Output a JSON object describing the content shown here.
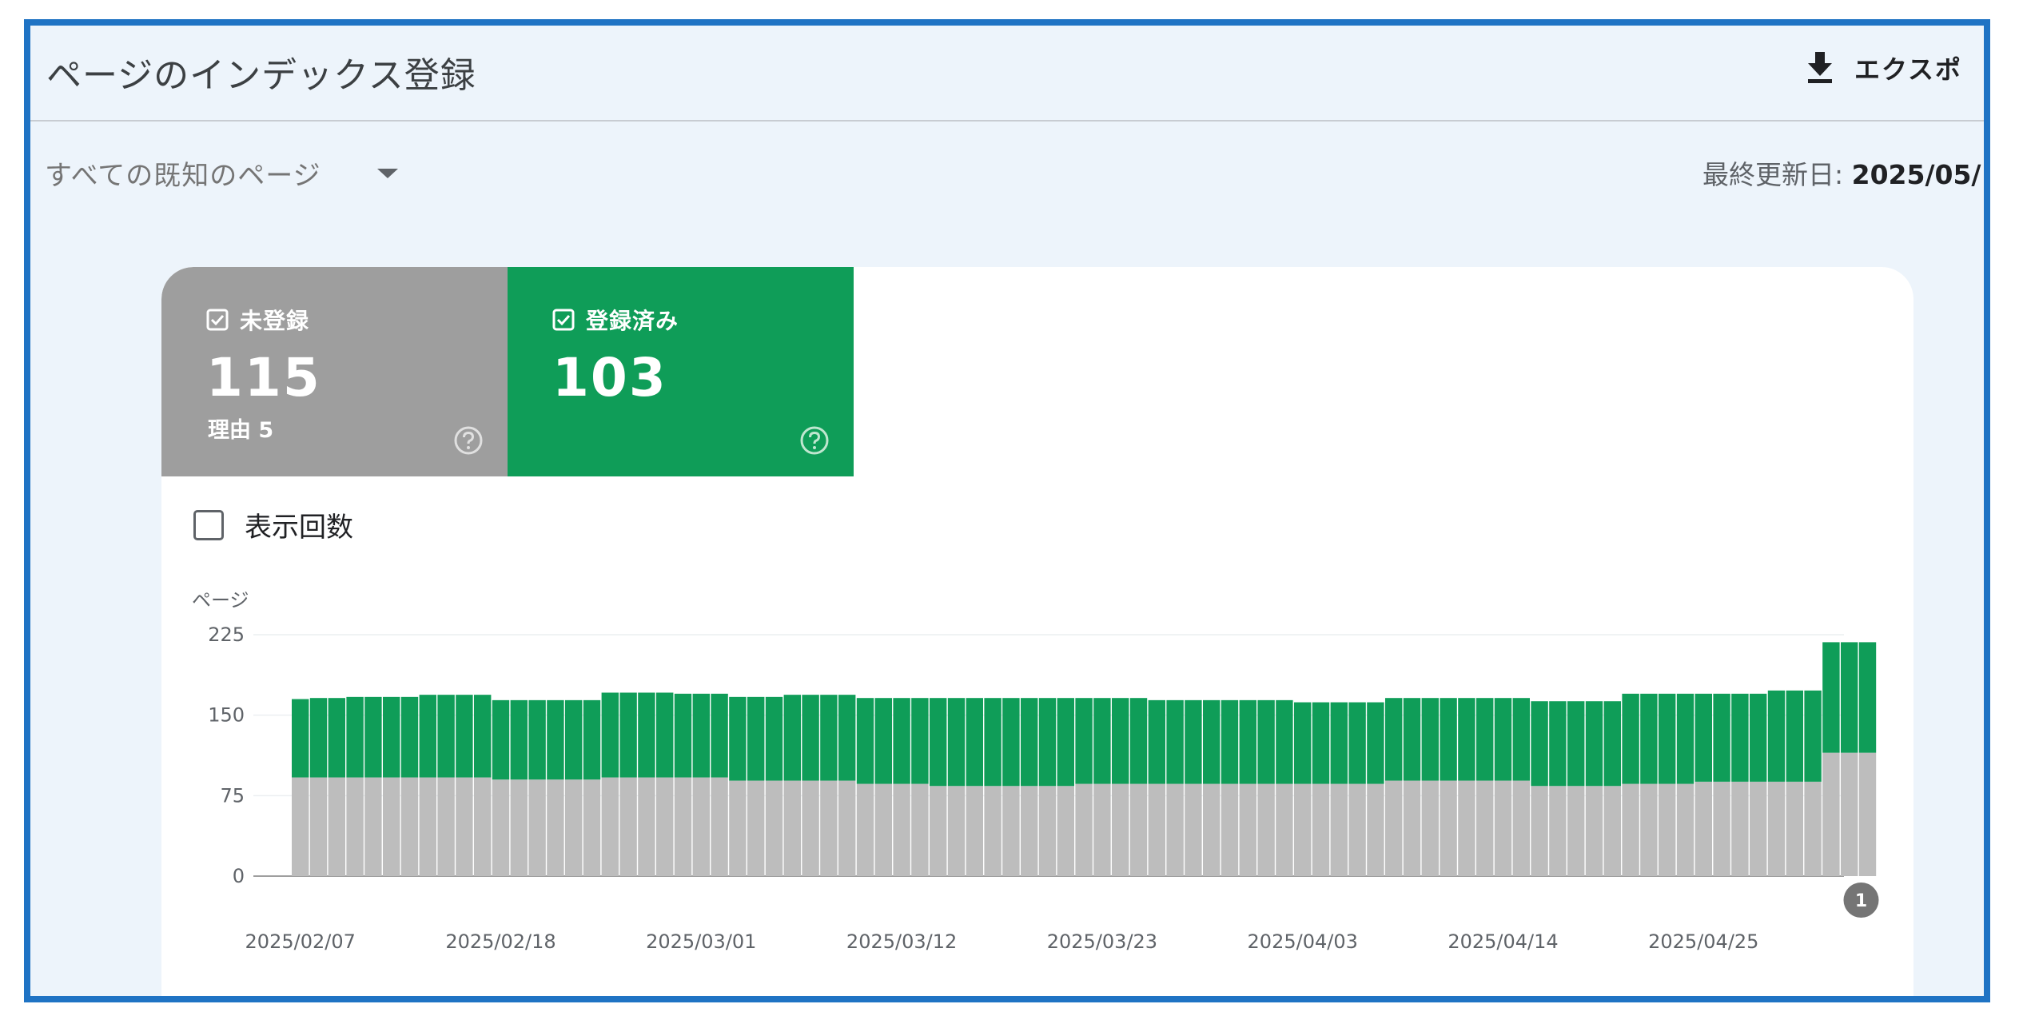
{
  "header": {
    "title": "ページのインデックス登録",
    "export_label": "エクスポ",
    "export_icon": "download-icon"
  },
  "filter": {
    "selected": "すべての既知のページ",
    "icon": "chevron-down-icon"
  },
  "last_updated": {
    "label": "最終更新日: ",
    "value": "2025/05/"
  },
  "summary": {
    "not_indexed": {
      "label": "未登録",
      "count": "115",
      "reason": "理由 5",
      "color": "#9e9e9e"
    },
    "indexed": {
      "label": "登録済み",
      "count": "103",
      "color": "#0f9d58"
    }
  },
  "impressions": {
    "label": "表示回数",
    "checked": false
  },
  "annotation_badge": "1",
  "chart_data": {
    "type": "bar",
    "stacked": true,
    "ylabel": "ページ",
    "ylim": [
      0,
      225
    ],
    "yticks": [
      0,
      75,
      150,
      225
    ],
    "xticks": [
      "2025/02/07",
      "2025/02/18",
      "2025/03/01",
      "2025/03/12",
      "2025/03/23",
      "2025/04/03",
      "2025/04/14",
      "2025/04/25"
    ],
    "grid": true,
    "start_date": "2025/02/07",
    "series": [
      {
        "name": "未登録",
        "color": "#bdbdbd",
        "values": [
          92,
          92,
          92,
          92,
          92,
          92,
          92,
          92,
          92,
          92,
          92,
          90,
          90,
          90,
          90,
          90,
          90,
          92,
          92,
          92,
          92,
          92,
          92,
          92,
          89,
          89,
          89,
          89,
          89,
          89,
          89,
          86,
          86,
          86,
          86,
          84,
          84,
          84,
          84,
          84,
          84,
          84,
          84,
          86,
          86,
          86,
          86,
          86,
          86,
          86,
          86,
          86,
          86,
          86,
          86,
          86,
          86,
          86,
          86,
          86,
          89,
          89,
          89,
          89,
          89,
          89,
          89,
          89,
          84,
          84,
          84,
          84,
          84,
          86,
          86,
          86,
          86,
          88,
          88,
          88,
          88,
          88,
          88,
          88,
          115,
          115,
          115
        ]
      },
      {
        "name": "登録済み",
        "color": "#0f9d58",
        "values": [
          73,
          74,
          74,
          75,
          75,
          75,
          75,
          77,
          77,
          77,
          77,
          74,
          74,
          74,
          74,
          74,
          74,
          79,
          79,
          79,
          79,
          78,
          78,
          78,
          78,
          78,
          78,
          80,
          80,
          80,
          80,
          80,
          80,
          80,
          80,
          82,
          82,
          82,
          82,
          82,
          82,
          82,
          82,
          80,
          80,
          80,
          80,
          78,
          78,
          78,
          78,
          78,
          78,
          78,
          78,
          76,
          76,
          76,
          76,
          76,
          77,
          77,
          77,
          77,
          77,
          77,
          77,
          77,
          79,
          79,
          79,
          79,
          79,
          84,
          84,
          84,
          84,
          82,
          82,
          82,
          82,
          85,
          85,
          85,
          103,
          103,
          103
        ]
      }
    ]
  }
}
